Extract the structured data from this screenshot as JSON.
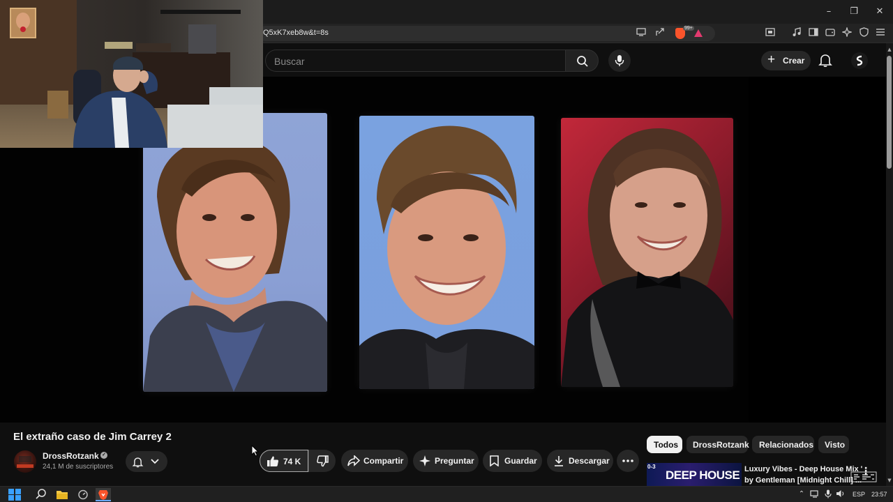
{
  "window": {
    "minimize": "–",
    "maximize": "❐",
    "close": "✕"
  },
  "browser": {
    "url": "Q5xK7xeb8w&t=8s",
    "shields_count": "99+"
  },
  "youtube": {
    "search_placeholder": "Buscar",
    "create_label": "Crear"
  },
  "video": {
    "title": "El extraño caso de Jim Carrey 2",
    "channel_name": "DrossRotzank",
    "subscribers": "24,1 M de suscriptores",
    "like_count": "74 K",
    "actions": {
      "share": "Compartir",
      "ask": "Preguntar",
      "save": "Guardar",
      "download": "Descargar"
    }
  },
  "chips": [
    "Todos",
    "DrossRotzank",
    "Relacionados",
    "Visto"
  ],
  "recommendation": {
    "title_line1": "Luxury Vibes - Deep House Mix '",
    "title_line2": "by Gentleman [Midnight Chill] ...",
    "thumb_text": "DEEP HOUSE",
    "thumb_badge": "0-3"
  },
  "taskbar": {
    "language": "ESP",
    "clock": "23:57"
  },
  "colors": {
    "page_bg": "#0f0f0f",
    "button_bg": "#272727",
    "brave_orange": "#fb542b"
  }
}
